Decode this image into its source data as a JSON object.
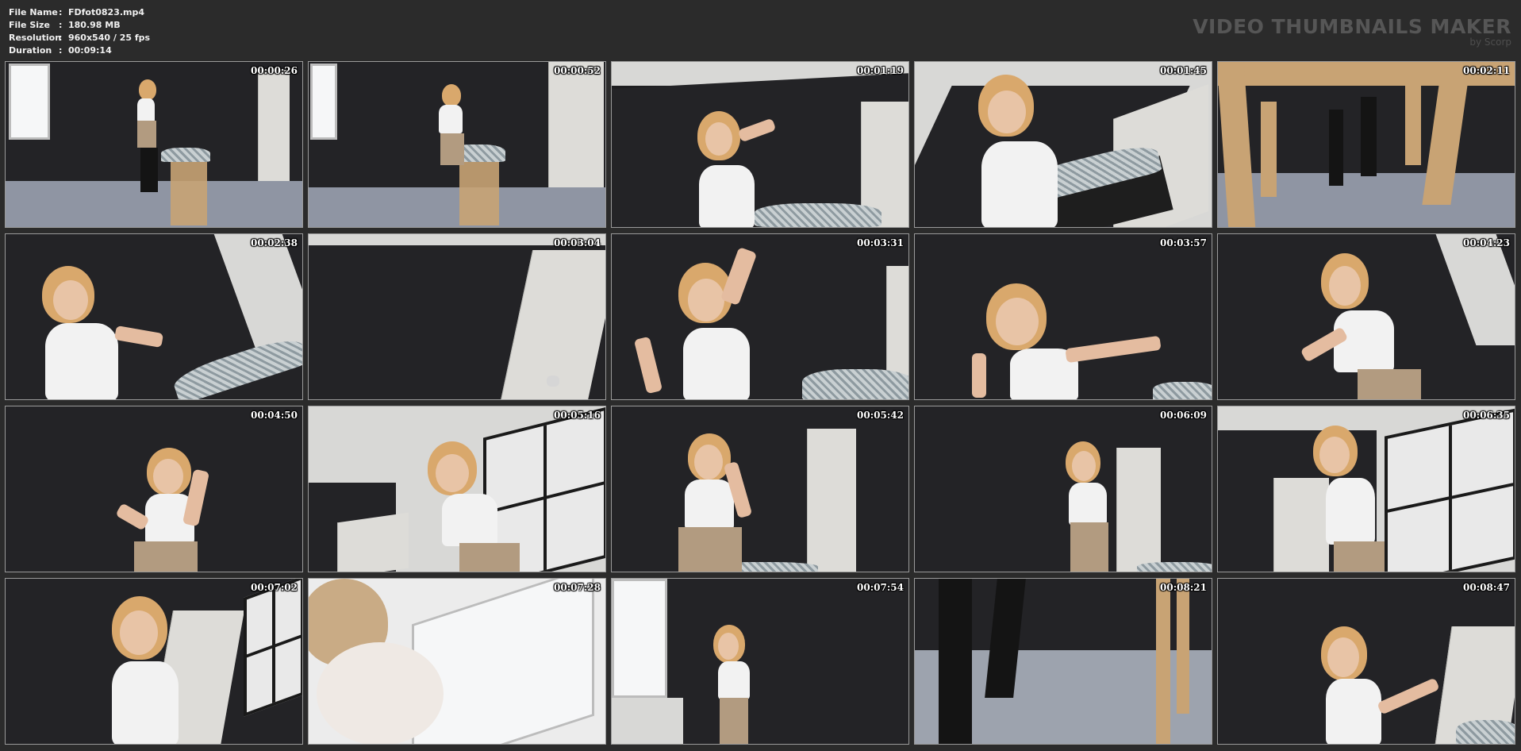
{
  "file_info": [
    {
      "key": "File Name",
      "sep": ":",
      "value": "FDfot0823.mp4"
    },
    {
      "key": "File Size",
      "sep": ":",
      "value": "180.98 MB"
    },
    {
      "key": "Resolution",
      "sep": ":",
      "value": "960x540 / 25 fps"
    },
    {
      "key": "Duration",
      "sep": ":",
      "value": "00:09:14"
    }
  ],
  "brand": {
    "title": "VIDEO THUMBNAILS MAKER",
    "subtitle": "by Scorp"
  },
  "thumbnails": [
    {
      "time": "00:00:26"
    },
    {
      "time": "00:00:52"
    },
    {
      "time": "00:01:19"
    },
    {
      "time": "00:01:45"
    },
    {
      "time": "00:02:11"
    },
    {
      "time": "00:02:38"
    },
    {
      "time": "00:03:04"
    },
    {
      "time": "00:03:31"
    },
    {
      "time": "00:03:57"
    },
    {
      "time": "00:04:23"
    },
    {
      "time": "00:04:50"
    },
    {
      "time": "00:05:16"
    },
    {
      "time": "00:05:42"
    },
    {
      "time": "00:06:09"
    },
    {
      "time": "00:06:35"
    },
    {
      "time": "00:07:02"
    },
    {
      "time": "00:07:28"
    },
    {
      "time": "00:07:54"
    },
    {
      "time": "00:08:21"
    },
    {
      "time": "00:08:47"
    }
  ],
  "colors": {
    "background": "#2b2b2b",
    "brand_text": "#565656",
    "frame_border": "#9a9a9a"
  }
}
